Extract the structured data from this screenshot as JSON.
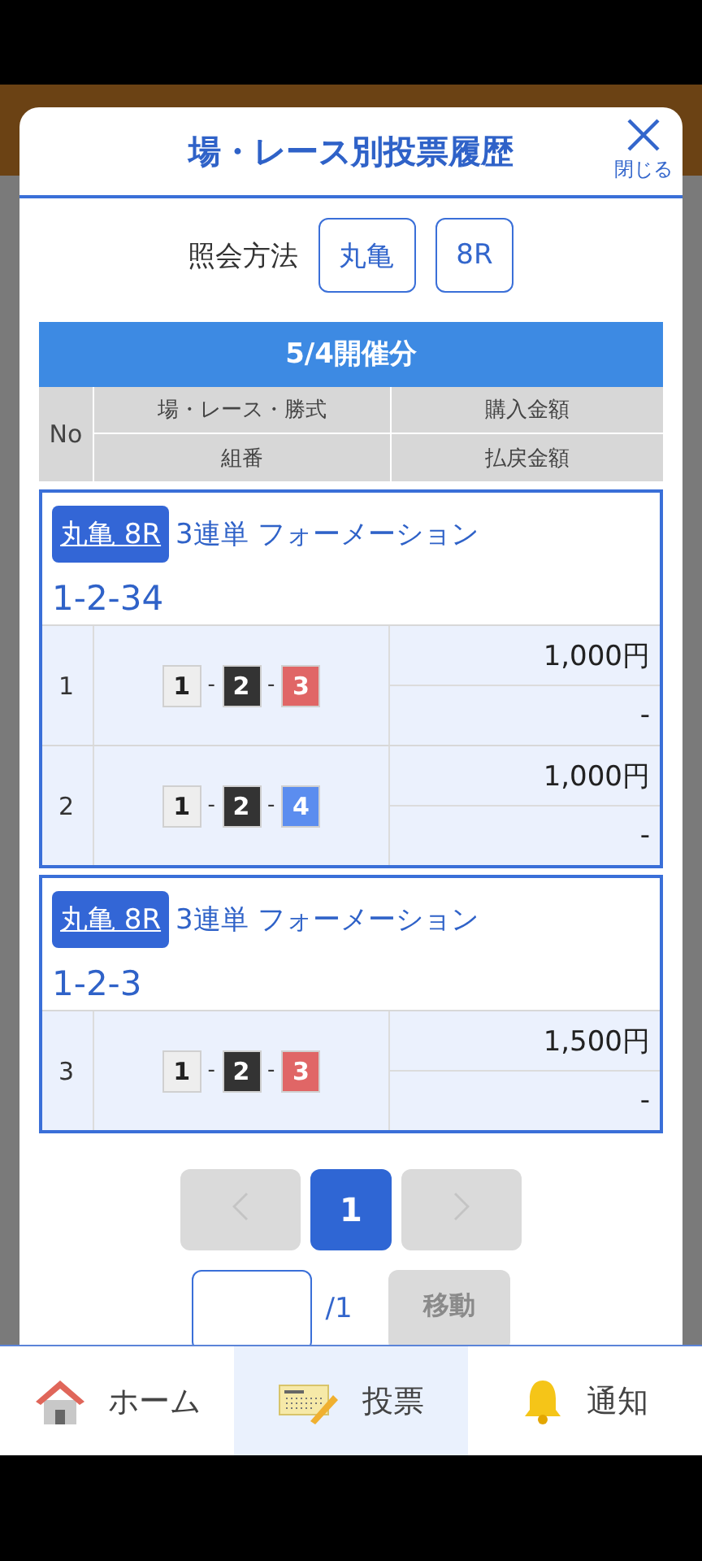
{
  "modal": {
    "title": "場・レース別投票履歴",
    "close_label": "閉じる",
    "query_label": "照会方法",
    "query_buttons": [
      "丸亀",
      "8R"
    ]
  },
  "table": {
    "caption": "5/4開催分",
    "headers": {
      "no": "No",
      "col_2_top": "場・レース・勝式",
      "col_2_bottom": "組番",
      "col_3_top": "購入金額",
      "col_3_bottom": "払戻金額"
    },
    "groups": [
      {
        "race": "丸亀 8R",
        "bet_type": "3連単 フォーメーション",
        "combination": "1-2-34",
        "rows": [
          {
            "no": "1",
            "combo": [
              {
                "kind": "boat",
                "text": "1",
                "color": "#eeeeee"
              },
              {
                "kind": "dash",
                "text": "-"
              },
              {
                "kind": "boat",
                "text": "2",
                "color": "#333333"
              },
              {
                "kind": "dash",
                "text": "-"
              },
              {
                "kind": "boat",
                "text": "3",
                "color": "#e06666"
              }
            ],
            "purchase": "1,000円",
            "payout": "-"
          },
          {
            "no": "2",
            "combo": [
              {
                "kind": "boat",
                "text": "1",
                "color": "#eeeeee"
              },
              {
                "kind": "dash",
                "text": "-"
              },
              {
                "kind": "boat",
                "text": "2",
                "color": "#333333"
              },
              {
                "kind": "dash",
                "text": "-"
              },
              {
                "kind": "boat",
                "text": "4",
                "color": "#5b8def"
              }
            ],
            "purchase": "1,000円",
            "payout": "-"
          }
        ]
      },
      {
        "race": "丸亀 8R",
        "bet_type": "3連単 フォーメーション",
        "combination": "1-2-3",
        "rows": [
          {
            "no": "3",
            "combo": [
              {
                "kind": "boat",
                "text": "1",
                "color": "#eeeeee"
              },
              {
                "kind": "dash",
                "text": "-"
              },
              {
                "kind": "boat",
                "text": "2",
                "color": "#333333"
              },
              {
                "kind": "dash",
                "text": "-"
              },
              {
                "kind": "boat",
                "text": "3",
                "color": "#e06666"
              }
            ],
            "purchase": "1,500円",
            "payout": "-"
          }
        ]
      }
    ]
  },
  "pagination": {
    "prev": {
      "disabled": true
    },
    "pages": [
      {
        "label": "1",
        "selected": true
      }
    ],
    "next": {
      "disabled": true
    },
    "page_suffix": "/1",
    "go_button": {
      "label": "移動",
      "disabled": true
    }
  },
  "bottom_nav": [
    {
      "kind": "home",
      "label": "ホーム",
      "selected": false
    },
    {
      "kind": "vote",
      "label": "投票",
      "selected": true
    },
    {
      "kind": "notify",
      "label": "通知",
      "selected": false
    }
  ]
}
